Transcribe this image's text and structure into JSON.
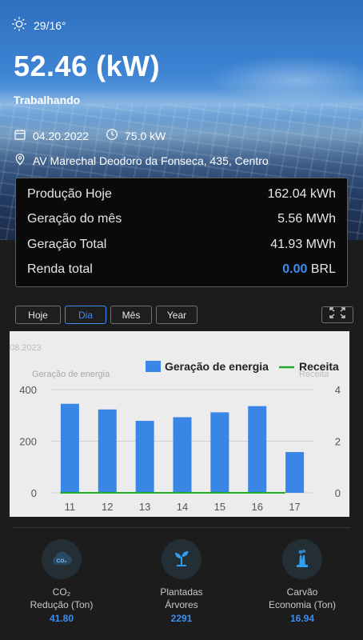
{
  "header": {
    "weather_icon": "sun-icon",
    "temperature": "29/16°",
    "power": "52.46 (kW)",
    "status": "Trabalhando",
    "date": "04.20.2022",
    "capacity": "75.0 kW",
    "address": "AV Marechal Deodoro da Fonseca, 435, Centro"
  },
  "summary": {
    "rows": [
      {
        "label": "Produção Hoje",
        "value": "162.04 kWh"
      },
      {
        "label": "Geração do mês",
        "value": "5.56 MWh"
      },
      {
        "label": "Geração Total",
        "value": "41.93 MWh"
      }
    ],
    "income_label": "Renda total",
    "income_value": "0.00",
    "income_currency": "BRL"
  },
  "tabs": [
    "Hoje",
    "Dia",
    "Mês",
    "Year"
  ],
  "active_tab": "Dia",
  "chart_data": {
    "type": "bar",
    "period_label": "08.2023",
    "categories": [
      "11",
      "12",
      "13",
      "14",
      "15",
      "16",
      "17"
    ],
    "series": [
      {
        "name": "Geração de energia",
        "values": [
          345,
          323,
          279,
          293,
          312,
          336,
          158
        ],
        "color": "#3a86e6",
        "axis": "left"
      },
      {
        "name": "Receita",
        "values": [
          0,
          0,
          0,
          0,
          0,
          0,
          0
        ],
        "color": "#1faa2a",
        "axis": "right",
        "type": "line"
      }
    ],
    "ylabel": "Geração de energia",
    "y2label": "Receita",
    "ylim": [
      0,
      400
    ],
    "y2lim": [
      0,
      4
    ],
    "yticks": [
      0,
      200,
      400
    ],
    "y2ticks": [
      0,
      2,
      4
    ],
    "legend_position": "top-right",
    "grid": true
  },
  "stats": [
    {
      "icon": "co2-cloud-icon",
      "line1": "CO₂",
      "line2": "Redução (Ton)",
      "value": "41.80"
    },
    {
      "icon": "plant-sprout-icon",
      "line1": "Plantadas",
      "line2": "Árvores",
      "value": "2291"
    },
    {
      "icon": "factory-icon",
      "line1": "Carvão",
      "line2": "Economia (Ton)",
      "value": "16.94"
    }
  ],
  "colors": {
    "accent": "#3d8ef0",
    "background": "#1c1c1c"
  }
}
